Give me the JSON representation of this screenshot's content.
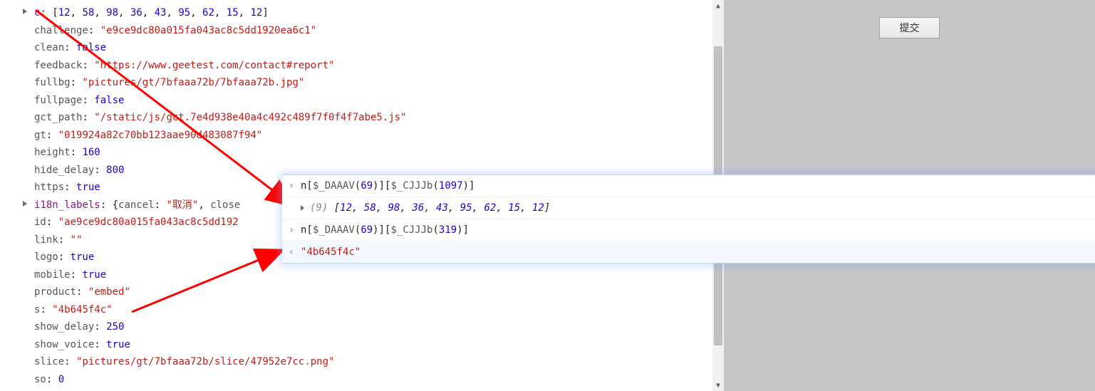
{
  "object": {
    "c": {
      "key": "c",
      "array": [
        12,
        58,
        98,
        36,
        43,
        95,
        62,
        15,
        12
      ]
    },
    "challenge": {
      "key": "challenge",
      "value": "e9ce9dc80a015fa043ac8c5dd1920ea6c1"
    },
    "clean": {
      "key": "clean",
      "value": "false"
    },
    "feedback": {
      "key": "feedback",
      "value": "https://www.geetest.com/contact#report"
    },
    "fullbg": {
      "key": "fullbg",
      "value": "pictures/gt/7bfaaa72b/7bfaaa72b.jpg"
    },
    "fullpage": {
      "key": "fullpage",
      "value": "false"
    },
    "gct_path": {
      "key": "gct_path",
      "value": "/static/js/gct.7e4d938e40a4c492c489f7f0f4f7abe5.js"
    },
    "gt": {
      "key": "gt",
      "value": "019924a82c70bb123aae90d483087f94"
    },
    "height": {
      "key": "height",
      "value": "160"
    },
    "hide_delay": {
      "key": "hide_delay",
      "value": "800"
    },
    "https": {
      "key": "https",
      "value": "true"
    },
    "i18n_labels": {
      "key": "i18n_labels",
      "preview_cancel_key": "cancel",
      "preview_cancel_value": "取消",
      "preview_next_key": "close"
    },
    "id": {
      "key": "id",
      "value": "ae9ce9dc80a015fa043ac8c5dd192"
    },
    "link": {
      "key": "link",
      "value": ""
    },
    "logo": {
      "key": "logo",
      "value": "true"
    },
    "mobile": {
      "key": "mobile",
      "value": "true"
    },
    "product": {
      "key": "product",
      "value": "embed"
    },
    "s": {
      "key": "s",
      "value": "4b645f4c"
    },
    "show_delay": {
      "key": "show_delay",
      "value": "250"
    },
    "show_voice": {
      "key": "show_voice",
      "value": "true"
    },
    "slice": {
      "key": "slice",
      "value": "pictures/gt/7bfaaa72b/slice/47952e7cc.png"
    },
    "so": {
      "key": "so",
      "value": "0"
    }
  },
  "console": {
    "line1": {
      "pre": "n[",
      "fn1": "$_DAAAV",
      "arg1": "69",
      "mid": ")][",
      "fn2": "$_CJJJb",
      "arg2": "1097",
      "post": ")]"
    },
    "line2": {
      "len_label": "(9)",
      "values": [
        12,
        58,
        98,
        36,
        43,
        95,
        62,
        15,
        12
      ]
    },
    "line3": {
      "pre": "n[",
      "fn1": "$_DAAAV",
      "arg1": "69",
      "mid": ")][",
      "fn2": "$_CJJJb",
      "arg2": "319",
      "post": ")]"
    },
    "line4": {
      "value": "4b645f4c"
    }
  },
  "submit_label": "提交",
  "colors": {
    "arrow": "#ff0000"
  }
}
